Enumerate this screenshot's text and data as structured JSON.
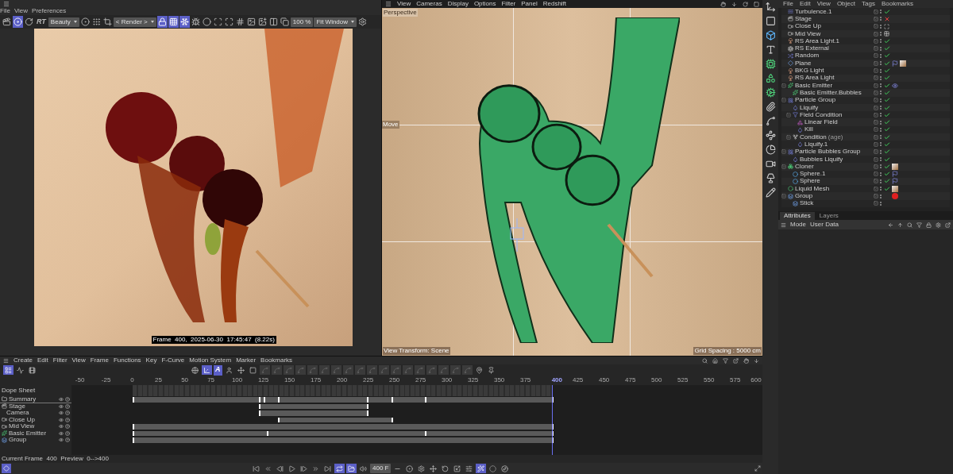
{
  "render_view": {
    "menu": [
      "File",
      "View",
      "Preferences"
    ],
    "toolbar": [
      {
        "kind": "clapper",
        "on": false
      },
      {
        "kind": "disc",
        "on": true
      },
      {
        "kind": "refresh",
        "on": false
      },
      {
        "kind": "text",
        "label": "RT"
      },
      {
        "kind": "dropdown",
        "label": "Beauty"
      },
      {
        "kind": "ball",
        "on": false
      },
      {
        "kind": "dots",
        "on": false
      },
      {
        "kind": "crop",
        "on": false
      },
      {
        "kind": "dropdown",
        "label": "< Render >"
      },
      {
        "kind": "lock",
        "on": true
      },
      {
        "kind": "grid",
        "on": true
      },
      {
        "kind": "snow",
        "on": true
      },
      {
        "kind": "bug",
        "on": false
      },
      {
        "kind": "circle",
        "on": false
      },
      {
        "kind": "focus",
        "on": false
      },
      {
        "kind": "expand",
        "on": false
      },
      {
        "kind": "stripes",
        "on": false
      },
      {
        "kind": "image",
        "on": false
      },
      {
        "kind": "add",
        "on": false
      },
      {
        "kind": "compare",
        "on": false
      },
      {
        "kind": "copy",
        "on": false
      },
      {
        "kind": "field",
        "label": "100 %"
      },
      {
        "kind": "dropdown",
        "label": "Fit Window"
      },
      {
        "kind": "gear",
        "on": false
      }
    ],
    "frame_info": "Frame  400,  2025-06-30  17:45:47  (8.22s)"
  },
  "viewport": {
    "menu": [
      "View",
      "Cameras",
      "Display",
      "Options",
      "Filter",
      "Panel",
      "Redshift"
    ],
    "camera": "Perspective",
    "tool": "Move",
    "view_transform": "View Transform: Scene",
    "grid_spacing": "Grid Spacing : 5000 cm"
  },
  "object_manager": {
    "menu": [
      "File",
      "Edit",
      "View",
      "Object",
      "Tags",
      "Bookmarks"
    ],
    "objects": [
      {
        "name": "Turbulence.1",
        "kind": "deformer",
        "flag": {
          "kind": "check"
        }
      },
      {
        "name": "Stage",
        "kind": "stage",
        "flag": {
          "kind": "cross"
        }
      },
      {
        "name": "Close Up",
        "kind": "camera",
        "flag": {
          "kind": "frame"
        }
      },
      {
        "name": "Mid View",
        "kind": "camera",
        "flag": {
          "kind": "checker"
        }
      },
      {
        "name": "RS Area Light.1",
        "kind": "light",
        "flag": {
          "kind": "check"
        }
      },
      {
        "name": "RS External",
        "kind": "external",
        "flag": {
          "kind": "check"
        }
      },
      {
        "name": "Random",
        "kind": "effector",
        "flag": {
          "kind": "check"
        }
      },
      {
        "name": "Plane",
        "kind": "plane",
        "flag": {
          "kind": "check"
        },
        "tags": [
          {
            "kind": "phong"
          },
          {
            "kind": "material"
          }
        ]
      },
      {
        "name": "BKG Light",
        "kind": "light",
        "flag": {
          "kind": "check"
        }
      },
      {
        "name": "RS Area Light",
        "kind": "light",
        "flag": {
          "kind": "check"
        }
      },
      {
        "name": "Basic Emitter",
        "kind": "emitter",
        "flag": {
          "kind": "check"
        },
        "tags": [
          {
            "kind": "eye"
          }
        ],
        "children": [
          {
            "name": "Basic Emitter.Bubbles",
            "kind": "emitter",
            "flag": {
              "kind": "check"
            }
          }
        ]
      },
      {
        "name": "Particle Group",
        "kind": "particles",
        "flag": {
          "kind": "check"
        },
        "children": [
          {
            "name": "Liquify",
            "kind": "modifier",
            "flag": {
              "kind": "check"
            }
          },
          {
            "name": "Field Condition",
            "kind": "field",
            "flag": {
              "kind": "check"
            },
            "children": [
              {
                "name": "Linear Field",
                "kind": "linear",
                "flag": {
                  "kind": "check"
                }
              },
              {
                "name": "Kill",
                "kind": "modifier",
                "flag": {
                  "kind": "check"
                }
              }
            ]
          },
          {
            "name": "Condition",
            "note": "(age)",
            "kind": "condition",
            "flag": {
              "kind": "check"
            },
            "children": [
              {
                "name": "Liquify.1",
                "kind": "modifier",
                "flag": {
                  "kind": "check"
                }
              }
            ]
          }
        ]
      },
      {
        "name": "Particle Bubbles Group",
        "kind": "particles",
        "flag": {
          "kind": "check"
        },
        "children": [
          {
            "name": "Bubbles Liquify",
            "kind": "modifier",
            "flag": {
              "kind": "check"
            }
          }
        ]
      },
      {
        "name": "Cloner",
        "kind": "cloner",
        "flag": {
          "kind": "check"
        },
        "tags": [
          {
            "kind": "material"
          }
        ],
        "children": [
          {
            "name": "Sphere.1",
            "kind": "sphere",
            "flag": {
              "kind": "check"
            },
            "tags": [
              {
                "kind": "phong"
              }
            ]
          },
          {
            "name": "Sphere",
            "kind": "sphere",
            "flag": {
              "kind": "check"
            },
            "tags": [
              {
                "kind": "phong"
              }
            ]
          }
        ]
      },
      {
        "name": "Liquid Mesh",
        "kind": "mesh",
        "flag": {
          "kind": "check"
        },
        "tags": [
          {
            "kind": "material"
          }
        ]
      },
      {
        "name": "Group",
        "kind": "group",
        "tags": [
          {
            "kind": "red"
          }
        ],
        "children": [
          {
            "name": "Stick",
            "kind": "group"
          }
        ]
      }
    ]
  },
  "attributes": {
    "tabs": [
      {
        "label": "Attributes",
        "selected": true
      },
      {
        "label": "Layers",
        "selected": false
      }
    ],
    "menu": [
      "Mode",
      "User Data"
    ]
  },
  "timeline": {
    "menu": [
      "Create",
      "Edit",
      "Filter",
      "View",
      "Frame",
      "Functions",
      "Key",
      "F-Curve",
      "Motion System",
      "Marker",
      "Bookmarks"
    ],
    "modes": [
      {
        "kind": "dope",
        "on": true
      },
      {
        "kind": "curve",
        "on": false
      },
      {
        "kind": "motion",
        "on": false
      }
    ],
    "toolbar": [
      {
        "kind": "sphere",
        "on": false
      },
      {
        "kind": "axis",
        "on": true
      },
      {
        "kind": "text",
        "label": "A",
        "on": true
      },
      {
        "kind": "person",
        "on": false
      },
      {
        "kind": "move",
        "on": false
      },
      {
        "kind": "frame",
        "on": false
      },
      {
        "kind": "dim",
        "on": false
      },
      {
        "kind": "dim",
        "on": false
      },
      {
        "kind": "dim",
        "on": false
      },
      {
        "kind": "dim",
        "on": false
      },
      {
        "kind": "dim",
        "on": false
      },
      {
        "kind": "dim",
        "on": false
      },
      {
        "kind": "dim",
        "on": false
      },
      {
        "kind": "dim",
        "on": false
      },
      {
        "kind": "dim",
        "on": false
      },
      {
        "kind": "dim",
        "on": false
      },
      {
        "kind": "dim",
        "on": false
      },
      {
        "kind": "dim",
        "on": false
      },
      {
        "kind": "dim",
        "on": false
      },
      {
        "kind": "dim",
        "on": false
      },
      {
        "kind": "dim",
        "on": false
      },
      {
        "kind": "dim",
        "on": false
      },
      {
        "kind": "dim",
        "on": false
      },
      {
        "kind": "dim",
        "on": false
      },
      {
        "kind": "pin",
        "on": false
      },
      {
        "kind": "pin2",
        "on": false
      }
    ],
    "ruler": [
      {
        "label": "-50",
        "selected": false
      },
      {
        "label": "-25",
        "selected": false
      },
      {
        "label": "0",
        "selected": false
      },
      {
        "label": "25",
        "selected": false
      },
      {
        "label": "50",
        "selected": false
      },
      {
        "label": "75",
        "selected": false
      },
      {
        "label": "100",
        "selected": false
      },
      {
        "label": "125",
        "selected": false
      },
      {
        "label": "150",
        "selected": false
      },
      {
        "label": "175",
        "selected": false
      },
      {
        "label": "200",
        "selected": false
      },
      {
        "label": "225",
        "selected": false
      },
      {
        "label": "250",
        "selected": false
      },
      {
        "label": "275",
        "selected": false
      },
      {
        "label": "300",
        "selected": false
      },
      {
        "label": "325",
        "selected": false
      },
      {
        "label": "350",
        "selected": false
      },
      {
        "label": "375",
        "selected": false
      },
      {
        "label": "400",
        "selected": true
      },
      {
        "label": "425",
        "selected": false
      },
      {
        "label": "450",
        "selected": false
      },
      {
        "label": "475",
        "selected": false
      },
      {
        "label": "500",
        "selected": false
      },
      {
        "label": "525",
        "selected": false
      },
      {
        "label": "550",
        "selected": false
      },
      {
        "label": "575",
        "selected": false
      },
      {
        "label": "600",
        "selected": false
      }
    ],
    "title": "Dope Sheet",
    "tracks": [
      {
        "name": "Summary",
        "kind": "folder"
      },
      {
        "name": "Stage",
        "kind": "stage",
        "children": [
          {
            "name": "Camera"
          }
        ]
      },
      {
        "name": "Close Up",
        "kind": "camera"
      },
      {
        "name": "Mid View",
        "kind": "camera"
      },
      {
        "name": "Basic Emitter",
        "kind": "emitter"
      },
      {
        "name": "Group",
        "kind": "group"
      }
    ],
    "status": "Current Frame  400  Preview  0-->400",
    "transport": [
      {
        "kind": "first",
        "on": false
      },
      {
        "kind": "prevkey",
        "on": false
      },
      {
        "kind": "prev",
        "on": false
      },
      {
        "kind": "play",
        "on": false
      },
      {
        "kind": "next",
        "on": false
      },
      {
        "kind": "nextkey",
        "on": false
      },
      {
        "kind": "last",
        "on": false
      },
      {
        "kind": "loop",
        "on": true
      },
      {
        "kind": "clip",
        "on": true
      },
      {
        "kind": "sound",
        "on": false
      },
      {
        "kind": "field",
        "label": "400 F"
      },
      {
        "kind": "minus",
        "on": false
      },
      {
        "kind": "record",
        "on": false
      },
      {
        "kind": "gear",
        "on": false
      },
      {
        "kind": "move",
        "on": false
      },
      {
        "kind": "rotate",
        "on": false
      },
      {
        "kind": "scale",
        "on": false
      },
      {
        "kind": "param",
        "on": false
      },
      {
        "kind": "pla",
        "on": true
      },
      {
        "kind": "dot",
        "on": false
      },
      {
        "kind": "nav",
        "on": false
      }
    ]
  }
}
